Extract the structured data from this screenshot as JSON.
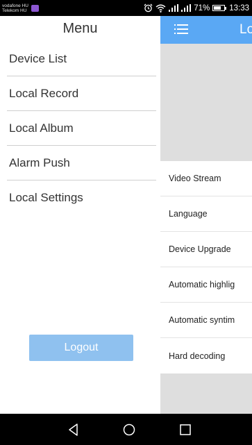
{
  "status_bar": {
    "carrier_1": "vodafone HU",
    "carrier_2": "Telekom HU",
    "battery_percent": "71%",
    "battery_level": 0.71,
    "time": "13:33",
    "icons": [
      "sim-app-icon",
      "alarm-icon",
      "wifi-icon",
      "signal-icon",
      "signal-icon",
      "battery-icon"
    ]
  },
  "drawer": {
    "title": "Menu",
    "items": [
      {
        "label": "Device List"
      },
      {
        "label": "Local Record"
      },
      {
        "label": "Local Album"
      },
      {
        "label": "Alarm Push"
      },
      {
        "label": "Local Settings"
      }
    ],
    "logout_label": "Logout"
  },
  "background_app": {
    "header_title_partial": "Lo",
    "menu_icon": "hamburger-icon",
    "header_color": "#5aa8f4",
    "settings": [
      {
        "label": "Video Stream"
      },
      {
        "label": "Language"
      },
      {
        "label": "Device Upgrade"
      },
      {
        "label": "Automatic highlig"
      },
      {
        "label": "Automatic syntim"
      },
      {
        "label": "Hard decoding"
      }
    ]
  },
  "colors": {
    "accent": "#5aa8f4",
    "logout_button": "#8fc1ef",
    "background_gray": "#dedede"
  },
  "nav_bar": {
    "icons": [
      "back-icon",
      "home-icon",
      "recent-apps-icon"
    ]
  }
}
